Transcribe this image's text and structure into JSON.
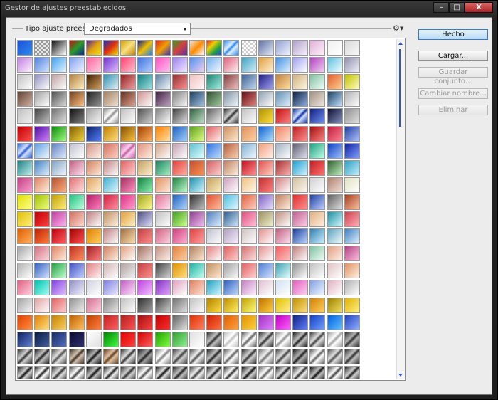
{
  "window": {
    "title": "Gestor de ajustes preestablecidos",
    "minimize_icon": "minimize-icon",
    "maximize_icon": "maximize-icon",
    "close_glyph": "X"
  },
  "preset_type": {
    "label": "Tipo ajuste preest.:",
    "selected": "Degradados"
  },
  "menu_icon": "gear-icon",
  "buttons": {
    "done": "Hecho",
    "load": "Cargar...",
    "save_set": "Guardar conjunto...",
    "rename": "Cambiar nombre...",
    "delete": "Eliminar"
  },
  "swatches": {
    "rows": [
      [
        "#1e4fd8|#2a8cf0",
        "#9a9a9a|#e8e8e8|checker",
        "#111|#fff",
        "#c01010|#2a9a2a|#0a2a8a",
        "#5020a0|#e0a010|#f0e020",
        "#1030c0|#e03010|#f0e000",
        "#d0a000|#f8e080|#c08000",
        "#102090|#f0c000|#2080f0",
        "#e02020|#f0a000|#4030b0",
        "#30a020|#d04040|#6030a0",
        "#e8e8e8|#ff8a00|#fff",
        "#e02020|#f0d000|#20a040|#2050e0",
        "#2a8cf0|#e0f0ff|stripe",
        "#d0d0d0|#fff|checker",
        "#6070a0|#e0e8f8",
        "#90a0d0|#f0f4ff",
        "#b0a0c8|#f8f0ff",
        "#e0b0d8|#fff0fa",
        "#f0f0f0|#fff",
        "#d8d8d8|#f8f8f8"
      ],
      [
        "#c080e0|#fff0ff",
        "#5080e0|#d0e4ff",
        "#40a0f0|#e0f4ff",
        "#80a0f0|#f0f4ff",
        "#ff60a0|#ffd0e0",
        "#7030d0|#e0c0ff",
        "#ff4070|#ffc0d0",
        "#4070e0|#b0d0ff",
        "#ff50c0|#ffc0f0",
        "#a080f0|#f0e8ff",
        "#5090f0|#f0d0f0",
        "#70b0f0|#f8f8ff",
        "#e06080|#fff0f0",
        "#40a0c0|#d0f0f8",
        "#e0a040|#fff0d0",
        "#4090e0|#e0f0ff",
        "#a0a0f0|#ffffff",
        "#b040c0|#f0d0f0",
        "#60c0e0|#f0ffff",
        "#9090b0|#f0f0f8"
      ],
      [
        "#c0c0c0|#fff",
        "#9090c0|#fff",
        "#c0a0a0|#fff",
        "#b08040|#fff0c0",
        "#402000|#d0a060",
        "#3090b0|#e0f0f8",
        "#902020|#f0a0a0",
        "#108080|#a0e0e0",
        "#6080a0|#f0f8ff",
        "#903030|#ff9090",
        "#f0c0c0|#fff8f8",
        "#208070|#a0f0e0",
        "#804040|#f0c0c0",
        "#406090|#c0d8f0",
        "#202080|#a0a0f0",
        "#c08040|#ffe0a0",
        "#d0b080|#fff8e0",
        "#80c0a0|#f0fff8",
        "#e06030|#ffd090",
        "#c0c000|#ffffc0"
      ],
      [
        "#604030|#d0b0a0",
        "#a0a0a0|#ffffff",
        "#505050|#d8d8d8",
        "#704020|#ffc080",
        "#202020|#909090",
        "#a08060|#f0e0d0",
        "#603020|#e0a090",
        "#d09090|#fff",
        "#402040|#c0a0c0",
        "#808080|#f8f8f8",
        "#204060|#a0c0e0",
        "#305030|#a0c8a0",
        "#8090a0|#f0f8ff",
        "#601010|#e08080",
        "#90a0b0|#fff",
        "#6090b0|#e0f0ff",
        "#102040|#90b0e0",
        "#a09080|#f0e8e0",
        "#204060|#c0e0ff",
        "#b0b0b0|#ffffff"
      ],
      [
        "#c0c0c0|#f0f0f0",
        "#404040|#c0c0c0",
        "#707070|#e0e0e0",
        "#101010|#808080",
        "#a0a0a0|#f8f8f8",
        "#909090|#ffffff|stripe",
        "#c0c0c0|#ffffff",
        "#505050|#d0d0d0",
        "#808080|#ffffff",
        "#404040|#e0e0e0",
        "#306040|#c0e0c8",
        "#606060|#f0f0f0",
        "#303030|#d0d0d0|stripe",
        "#c0c0c0|#ffffff",
        "#b09000|#ffe040",
        "#c01010|#ff8080",
        "#1030a0|#d0e0ff|stripe",
        "#102080|#7090f0",
        "#101030|#8090c0",
        "#909090|#e0e0e0"
      ],
      [
        "#c00000|#ff5050",
        "#5010a0|#d080ff",
        "#0a8a0a|#a0ff80",
        "#806000|#f0d040",
        "#102060|#5080ff",
        "#c08000|#ffe080",
        "#805000|#ffc040",
        "#a04000|#ffb060",
        "#ff8000|#ffe0a0",
        "#2060c0|#a0d0ff",
        "#60a020|#e0ff80",
        "#e06060|#fff0f0",
        "#d09060|#ffe8d0",
        "#e09060|#ffd0a0",
        "#1060d0|#b0e0ff",
        "#f08060|#ffe0d0",
        "#c02020|#ff9090",
        "#a01010|#ff8080",
        "#c02040|#ff8090",
        "#2040a0|#b0c0ff"
      ],
      [
        "#3060d0|#d0e0ff|stripe",
        "#60a0e0|#f0f8ff",
        "#6080c0|#e0ecff",
        "#c0c0d0|#ffffff",
        "#d09080|#fff0e8",
        "#d07060|#ffd0c0",
        "#c060a0|#ffd0f0|stripe",
        "#e09080|#fff0e0",
        "#d0a080|#fff",
        "#c0a0b0|#fff",
        "#60c0d0|#e0ffff",
        "#3070e0|#c0e0ff",
        "#b06040|#ffd0b0",
        "#80b0d0|#f0f8ff",
        "#f0a080|#fff0e8",
        "#a0b0c0|#ffffff",
        "#606070|#e0e0f0",
        "#20a080|#c0ffe8",
        "#1040c0|#a0c0ff",
        "#1020a0|#80a0ff"
      ],
      [
        "#208080|#c0f0f0",
        "#4080c0|#e0f0ff",
        "#80a0c0|#f0f8ff",
        "#c06080|#ffe0f0",
        "#d08060|#ffe8d8",
        "#c08080|#fff",
        "#e06060|#ffd0d0",
        "#c0a060|#fff0d0",
        "#208060|#a0f0c0",
        "#e04040|#ffb0a0",
        "#c05030|#ff9050",
        "#d06060|#ffd0d0",
        "#c08060|#fff0e0",
        "#c01020|#ff9090",
        "#e05050|#ffd0c0",
        "#a03030|#ffb0b0",
        "#20a0d0|#d0f4ff",
        "#c02020|#ff7070",
        "#306030|#c0f0c0",
        "#30a0c0|#c0f0ff"
      ],
      [
        "#c04080|#ffa0d0",
        "#e08060|#fff0e0",
        "#b05030|#ffb080",
        "#e07070|#ffe0e0",
        "#e0a060|#fff0d0",
        "#40b0d0|#e0f8ff",
        "#a03060|#ff90c0",
        "#108040|#90f0b0",
        "#e09060|#ffe8d8",
        "#208040|#c0ffd0",
        "#2090b0|#d0f8ff",
        "#c0a060|#fff0c0",
        "#d0a0c0|#fff",
        "#f0c080|#fff8e8",
        "#c03030|#ff8080",
        "#d08080|#fff",
        "#d0c0a0|#fff8f0",
        "#d0d0d0|#fff",
        "#b08070|#f0e0d8",
        "#e0e0c0|#fff"
      ],
      [
        "#e0e000|#ffff90",
        "#a0c000|#f0ff80",
        "#c0a000|#fff080",
        "#20c080|#c0ffe0",
        "#b02060|#ff80c0",
        "#d02040|#ff90a0",
        "#e03080|#ffa0d0",
        "#a0a020|#ffff90",
        "#e07090|#ffe0f0",
        "#2060c0|#b0d8ff",
        "#303030|#c0c0c0",
        "#e05030|#ffc0a0",
        "#50c0e0|#e0f8ff",
        "#e06040|#ffd0c0",
        "#8060c0|#e8e0ff",
        "#c08060|#fff0e0",
        "#e03030|#ff9090",
        "#2040a0|#c0d0ff",
        "#606060|#e0e0e0",
        "#a04020|#ffc0a0"
      ],
      [
        "#e0c000|#fff080",
        "#c00000|#ff4040",
        "#c040a0|#ffb0f0",
        "#d07060|#ffd8d0",
        "#c08080|#ffffff",
        "#c09060|#fff0e0",
        "#e0a040|#fff0c0",
        "#505080|#e0e0ff",
        "#c0c0c0|#ffffff",
        "#40a020|#d0ff90",
        "#904090|#f0c0f0",
        "#5080c0|#e0f0ff",
        "#306090|#d0e8ff",
        "#e05080|#ffc0d8",
        "#a09060|#f0f0d0",
        "#c09080|#fff",
        "#c06090|#ffd0e8",
        "#e0b080|#fff0e0",
        "#2090a0|#d0f8ff",
        "#d04050|#ffb0b8"
      ],
      [
        "#e06000|#ffb060",
        "#c02000|#ff8040",
        "#c00010|#ff6060",
        "#a00000|#ff5050",
        "#e08000|#ffd060",
        "#c08080|#fff",
        "#a07040|#ffe0b0",
        "#c04040|#ff9090",
        "#d06080|#ffd0e0",
        "#d04080|#ffb0d0",
        "#e04040|#ffa0a0",
        "#c0c0d0|#ffffff",
        "#b0a0c0|#f8f0ff",
        "#d0c0c0|#fff",
        "#e09090|#fff",
        "#c06080|#ffe0f0",
        "#2040a0|#c0d8ff",
        "#3080b0|#d0f0ff",
        "#60a0c0|#f0ffff",
        "#4080c0|#e0f0ff"
      ],
      [
        "#a0a0a0|#ffffff",
        "#d07080|#ffd8e0",
        "#e08060|#fff0e0",
        "#c03020|#ff9060",
        "#a02020|#ff8080",
        "#d08060|#fff0e0",
        "#e0a080|#fff",
        "#a07060|#f0e0d8",
        "#c09080|#fff0e8",
        "#e08040|#ffd0a0",
        "#b08060|#ffe8d0",
        "#e08080|#fff",
        "#e06060|#ffd0d0",
        "#d07070|#ffe0e0",
        "#e09090|#fff",
        "#f06060|#ffc0c0",
        "#c08080|#fff",
        "#80c0a0|#f0fff8",
        "#e0a080|#fff0e8",
        "#b04080|#ffc0e0"
      ],
      [
        "#b0b0b0|#ffffff",
        "#3060c0|#d0e0ff",
        "#20a040|#c0ffd0",
        "#4050c0|#c0d0ff",
        "#e08080|#fff0f0",
        "#d0b0b0|#fff",
        "#b0a0a0|#f0f0f0",
        "#c04040|#ff9090",
        "#404040|#d0d0d0",
        "#e09000|#ffe080",
        "#20b0a0|#c0fff0",
        "#c09060|#ffe8d0",
        "#a0a0a0|#f8f8f8",
        "#e06060|#ffd0d0",
        "#5080d0|#d0e0ff",
        "#40a0b0|#e0ffff",
        "#909090|#ffffff",
        "#c0c0c0|#ffffff",
        "#e0c0c0|#fff",
        "#e09060|#fff0e0"
      ],
      [
        "#e06080|#ffd0e0",
        "#00c0b0|#a0fff0",
        "#8040e0|#e0c0ff",
        "#9090c0|#f0f0ff",
        "#d0d0e0|#fff",
        "#8080e0|#e8e8ff",
        "#c060c0|#ffe0ff",
        "#c040e0|#f0c0ff",
        "#8030c0|#e0a0ff",
        "#e0a0c0|#fff",
        "#e08060|#ffe0d0",
        "#20a0c0|#d0f8ff",
        "#3060c0|#c0d8ff",
        "#c080c0|#fff0ff",
        "#e0c0d0|#fff",
        "#d0e0f0|#fff",
        "#e060c0|#ffd0f0",
        "#80a0e0|#f0f8ff",
        "#e0b0c0|#fff",
        "#b0b0b0|#fff"
      ],
      [
        "#a0a0a0|#f8f8f8",
        "#e0a0a0|#fff",
        "#e06060|#ffd0d0",
        "#909090|#f0f0f0",
        "#d07090|#ffd0e0",
        "#808080|#e8e8e8",
        "#c0c0c0|#fff",
        "#303030|#a0a0a0",
        "#404040|#d0d0d0",
        "#707070|#e0e0e0",
        "#c0c0c0|#ffffff",
        "#b08000|#ffe040",
        "#c09000|#fff060",
        "#c0a000|#ffff80",
        "#c07000|#ffd040",
        "#e0c000|#fff090",
        "#c09000|#ffe080",
        "#d08000|#ffd060",
        "#a08000|#f0e060",
        "#e0b000|#fff080"
      ],
      [
        "#e04000|#ff9040",
        "#e08000|#ffe080",
        "#c08000|#ffd060",
        "#c06000|#ffc060",
        "#c04000|#ff8040",
        "#c02020|#ff6060",
        "#b02020|#ff5050",
        "#a01010|#ff4040",
        "#c00000|#ff3030",
        "#606060|#e0e0e0",
        "#e03000|#ff8060",
        "#d02000|#ff7040",
        "#e06000|#ffa040",
        "#e09000|#ffd040",
        "#a030c0|#e080ff",
        "#c000c0|#ff60ff",
        "#102080|#6080ff",
        "#1040c0|#70a0ff",
        "#0060e0|#60c0ff",
        "#2040c0|#90b0ff"
      ],
      [
        "#102060|#6080d0",
        "#0a1a40|#4060a0",
        "#1a2a60|#5070c0",
        "#0a0a30|#303070",
        "#ffffff|#e0e0e0",
        "#008000|#40ff40",
        "#e00000|#ff4040",
        "#d00000|#ff6060",
        "#20a000|#80ff40",
        "#30a030|#90f090",
        "#e0e0e0|#ffffff",
        "#303030|#c0c0c0|stripe",
        "#c0c0c0|#ffffff|stripe",
        "#606060|#ffffff|stripe",
        "#303030|#d0d0d0|stripe",
        "#909090|#ffffff|stripe",
        "#202020|#c0c0c0|stripe",
        "#404040|#e0e0e0|stripe",
        "#a0a0a0|#ffffff|stripe",
        "#303030|#b0b0b0|stripe"
      ],
      [
        "#303030|#d0d0d0|stripe",
        "#202020|#c0c0c0|stripe",
        "#505050|#e0e0e0|stripe",
        "#403020|#d0c0b0|stripe",
        "#101010|#b0b0b0|stripe",
        "#604020|#e0c0a0|stripe",
        "#303030|#e0e0e0|stripe",
        "#202020|#a0a0a0|stripe",
        "#808080|#ffffff|stripe",
        "#404040|#d0d0d0|stripe",
        "#505050|#f0f0f0|stripe",
        "#202020|#c0c0c0|stripe",
        "#606060|#ffffff|stripe",
        "#303030|#d0d0d0|stripe",
        "#707070|#f0f0f0|stripe",
        "#404040|#e0e0e0|stripe",
        "#202020|#b0b0b0|stripe",
        "#606060|#ffffff|stripe",
        "#505050|#e0e0e0|stripe",
        "#303030|#c0c0c0|stripe"
      ],
      [
        "#101010|#d0d0d0|stripe",
        "#202020|#ffffff|stripe",
        "#303030|#e0e0e0|stripe",
        "#404040|#ffffff|stripe",
        "#101010|#c0c0c0|stripe",
        "#202020|#f0f0f0|stripe",
        "#303030|#d0d0d0|stripe",
        "#505050|#ffffff|stripe",
        "#101010|#e0e0e0|stripe",
        "#202020|#c0c0c0|stripe",
        "#404040|#f0f0f0|stripe",
        "#202020|#e0e0e0|stripe",
        "#303030|#ffffff|stripe",
        "#101010|#d0d0d0|stripe",
        "#606060|#ffffff|stripe",
        "#202020|#e0e0e0|stripe",
        "#303030|#f0f0f0|stripe",
        "#101010|#c0c0c0|stripe",
        "#404040|#ffffff|stripe",
        "#202020|#d0d0d0|stripe"
      ]
    ]
  }
}
